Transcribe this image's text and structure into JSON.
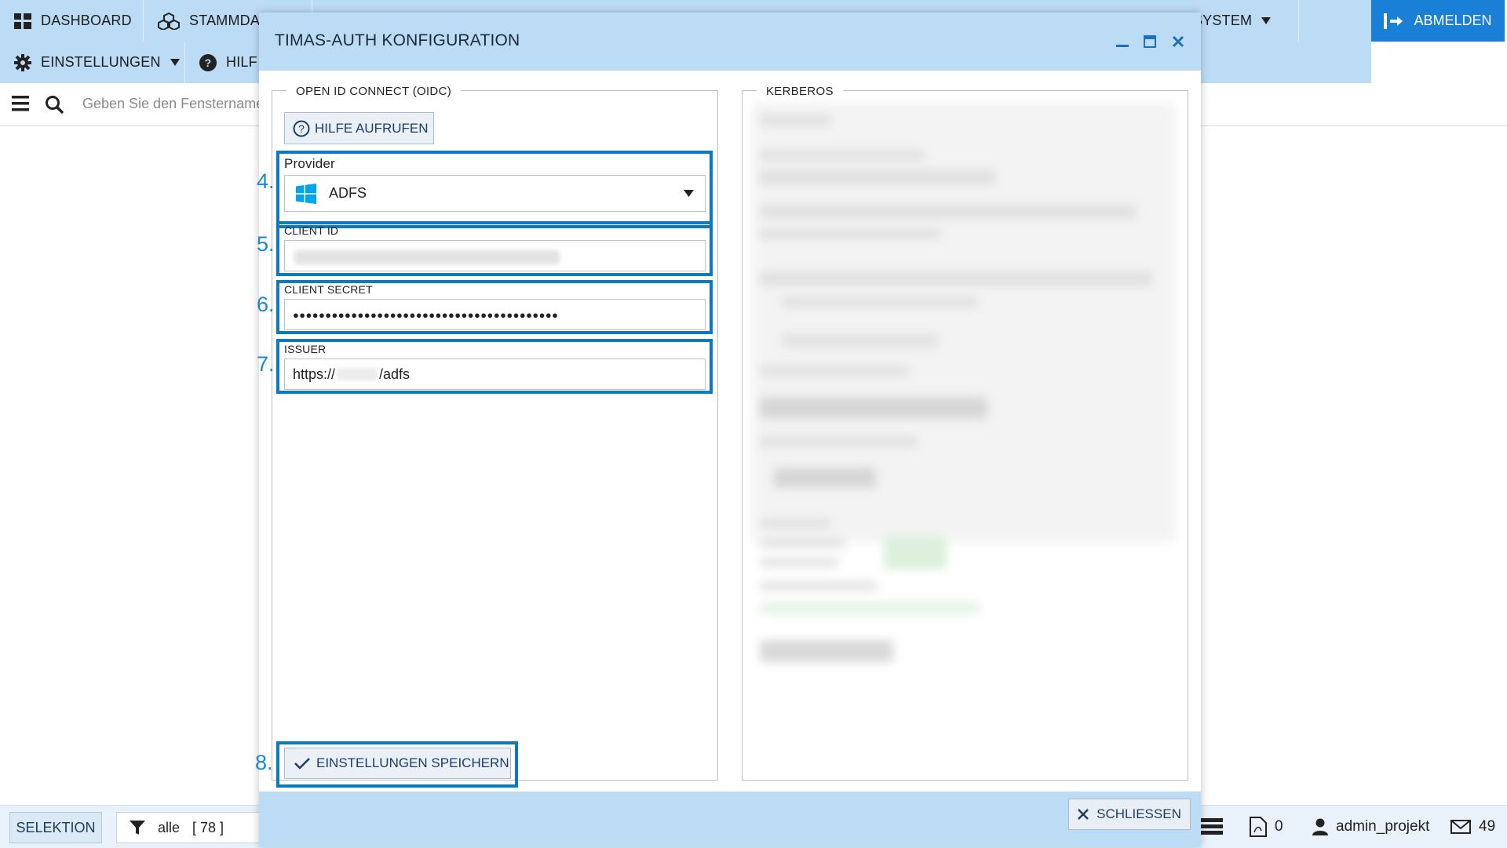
{
  "menu": {
    "dashboard": "DASHBOARD",
    "stammdaten": "STAMMDAT",
    "system": "SYSTEM",
    "einstellungen": "EINSTELLUNGEN",
    "hilfe": "HILF",
    "logout": "ABMELDEN"
  },
  "search": {
    "placeholder": "Geben Sie den Fenstername"
  },
  "modal": {
    "title": "TIMAS-AUTH KONFIGURATION",
    "oidc_legend": "OPEN ID CONNECT (OIDC)",
    "kerberos_legend": "KERBEROS",
    "help_button": "HILFE AUFRUFEN",
    "provider_label": "Provider",
    "provider_value": "ADFS",
    "client_id_label": "CLIENT ID",
    "client_secret_label": "CLIENT SECRET",
    "client_secret_value": "●●●●●●●●●●●●●●●●●●●●●●●●●●●●●●●●●●●●●●●●●",
    "issuer_label": "ISSUER",
    "issuer_prefix": "https://",
    "issuer_suffix": "/adfs",
    "save_button": "EINSTELLUNGEN SPEICHERN",
    "close_button": "SCHLIESSEN"
  },
  "steps": {
    "s4": "4.",
    "s5": "5.",
    "s6": "6.",
    "s7": "7.",
    "s8": "8."
  },
  "statusbar": {
    "selection": "SELEKTION",
    "filter_value": "alle",
    "filter_count": "[ 78 ]",
    "pdf_count": "0",
    "user": "admin_projekt",
    "mail_count": "49"
  },
  "colors": {
    "accent": "#1a7fd6",
    "header": "#bcdcf6",
    "highlight": "#0b7bbf",
    "step": "#1a88c9"
  }
}
